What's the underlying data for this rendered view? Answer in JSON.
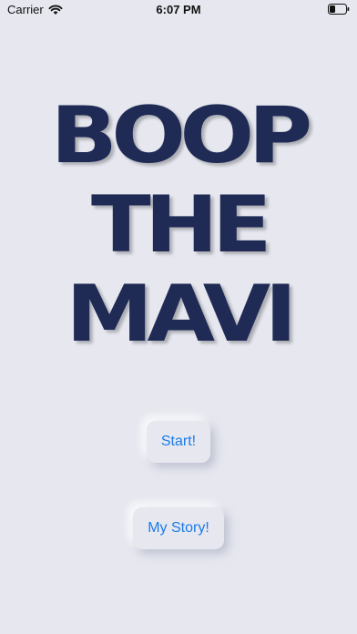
{
  "status_bar": {
    "carrier": "Carrier",
    "time": "6:07 PM",
    "wifi_icon": "wifi-icon",
    "battery_icon": "battery-icon"
  },
  "logo": {
    "line1": "BOOP",
    "line2": "THE",
    "line3": "MAVI"
  },
  "buttons": {
    "start_label": "Start!",
    "story_label": "My Story!"
  },
  "colors": {
    "background": "#e6e7ef",
    "logo": "#1f2b55",
    "button_text": "#1c7bea"
  }
}
